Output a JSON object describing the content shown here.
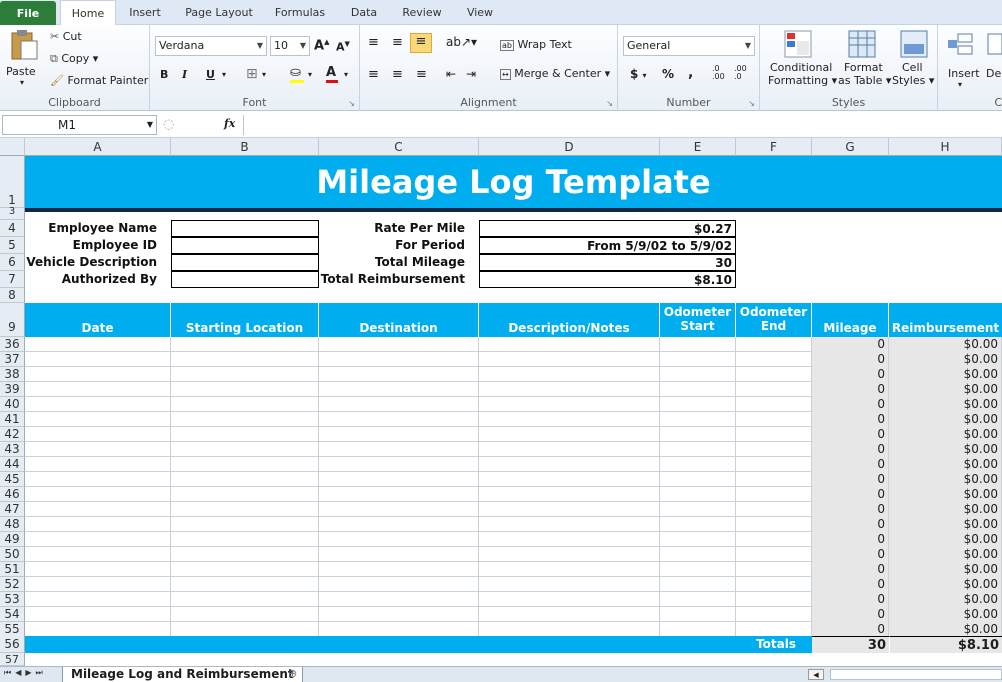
{
  "ribbon_tabs": [
    "File",
    "Home",
    "Insert",
    "Page Layout",
    "Formulas",
    "Data",
    "Review",
    "View"
  ],
  "clipboard": {
    "paste": "Paste",
    "cut": "Cut",
    "copy": "Copy",
    "format_painter": "Format Painter",
    "label": "Clipboard"
  },
  "font": {
    "name": "Verdana",
    "size": "10",
    "label": "Font",
    "bold": "B",
    "italic": "I",
    "underline": "U"
  },
  "alignment": {
    "wrap_text": "Wrap Text",
    "merge_center": "Merge & Center",
    "label": "Alignment"
  },
  "number": {
    "format": "General",
    "currency": "$",
    "percent": "%",
    "comma": ",",
    "label": "Number"
  },
  "styles": {
    "conditional": "Conditional",
    "conditional2": "Formatting",
    "format_table": "Format",
    "format_table2": "as Table",
    "cell_styles": "Cell",
    "cell_styles2": "Styles",
    "label": "Styles"
  },
  "cells": {
    "insert": "Insert",
    "delete": "De",
    "label": "C"
  },
  "formula_bar": {
    "name_box": "M1",
    "fx": "fx",
    "formula": ""
  },
  "columns": [
    "A",
    "B",
    "C",
    "D",
    "E",
    "F",
    "G",
    "H"
  ],
  "sheet": {
    "title": "Mileage Log Template",
    "employee_name_label": "Employee Name",
    "employee_id_label": "Employee ID",
    "vehicle_label": "Vehicle Description",
    "authorized_label": "Authorized By",
    "rate_label": "Rate Per Mile",
    "period_label": "For Period",
    "total_mileage_label": "Total Mileage",
    "total_reimb_label": "Total Reimbursement",
    "rate": "$0.27",
    "period": "From 5/9/02 to 5/9/02",
    "total_mileage": "30",
    "total_reimb": "$8.10",
    "headers": [
      "Date",
      "Starting Location",
      "Destination",
      "Description/Notes",
      "Odometer Start",
      "Odometer End",
      "Mileage",
      "Reimbursement"
    ],
    "odo_start_1": "Odometer",
    "odo_start_2": "Start",
    "odo_end_1": "Odometer",
    "odo_end_2": "End",
    "rows": [
      {
        "n": "36",
        "mileage": "0",
        "reimb": "$0.00"
      },
      {
        "n": "37",
        "mileage": "0",
        "reimb": "$0.00"
      },
      {
        "n": "38",
        "mileage": "0",
        "reimb": "$0.00"
      },
      {
        "n": "39",
        "mileage": "0",
        "reimb": "$0.00"
      },
      {
        "n": "40",
        "mileage": "0",
        "reimb": "$0.00"
      },
      {
        "n": "41",
        "mileage": "0",
        "reimb": "$0.00"
      },
      {
        "n": "42",
        "mileage": "0",
        "reimb": "$0.00"
      },
      {
        "n": "43",
        "mileage": "0",
        "reimb": "$0.00"
      },
      {
        "n": "44",
        "mileage": "0",
        "reimb": "$0.00"
      },
      {
        "n": "45",
        "mileage": "0",
        "reimb": "$0.00"
      },
      {
        "n": "46",
        "mileage": "0",
        "reimb": "$0.00"
      },
      {
        "n": "47",
        "mileage": "0",
        "reimb": "$0.00"
      },
      {
        "n": "48",
        "mileage": "0",
        "reimb": "$0.00"
      },
      {
        "n": "49",
        "mileage": "0",
        "reimb": "$0.00"
      },
      {
        "n": "50",
        "mileage": "0",
        "reimb": "$0.00"
      },
      {
        "n": "51",
        "mileage": "0",
        "reimb": "$0.00"
      },
      {
        "n": "52",
        "mileage": "0",
        "reimb": "$0.00"
      },
      {
        "n": "53",
        "mileage": "0",
        "reimb": "$0.00"
      },
      {
        "n": "54",
        "mileage": "0",
        "reimb": "$0.00"
      },
      {
        "n": "55",
        "mileage": "0",
        "reimb": "$0.00"
      }
    ],
    "totals_label": "Totals",
    "totals_mileage": "30",
    "totals_reimb": "$8.10",
    "row_numbers_top": [
      "1",
      "3",
      "4",
      "5",
      "6",
      "7",
      "8",
      "9"
    ],
    "row_56": "56",
    "row_57": "57"
  },
  "sheet_tab": "Mileage Log and Reimbursement",
  "colors": {
    "accent": "#00aeef",
    "dark": "#0d2944",
    "file_tab": "#2c7c3a"
  }
}
